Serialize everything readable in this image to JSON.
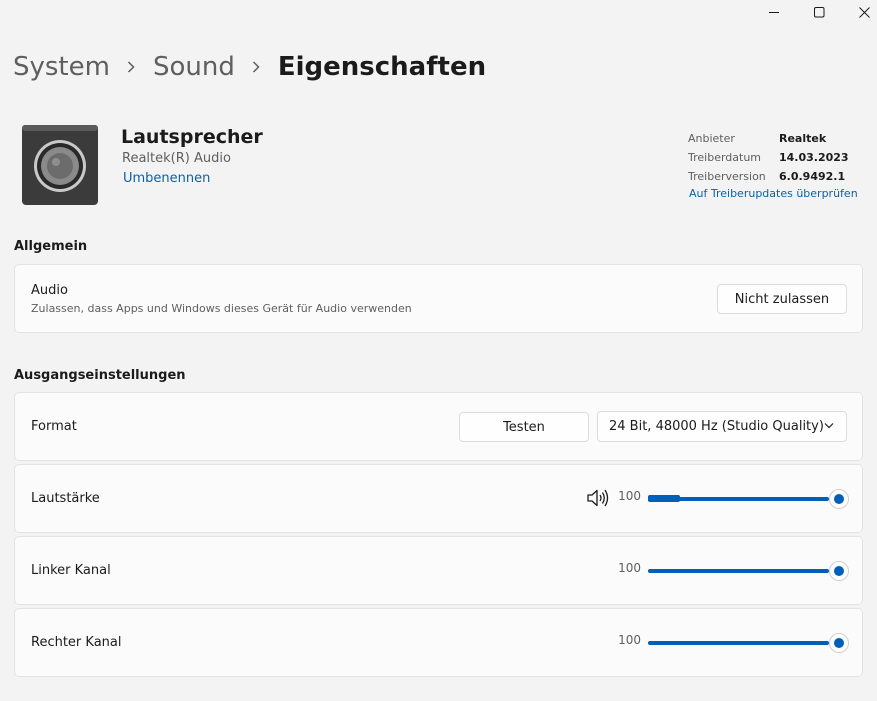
{
  "window_controls": {
    "minimize_icon": "minimize-icon",
    "maximize_icon": "maximize-icon",
    "close_icon": "close-icon"
  },
  "breadcrumb": [
    "System",
    "Sound",
    "Eigenschaften"
  ],
  "device": {
    "icon": "speaker-icon",
    "name": "Lautsprecher",
    "subtitle": "Realtek(R) Audio",
    "rename_link": "Umbenennen"
  },
  "driver_info": {
    "rows": [
      {
        "label": "Anbieter",
        "value": "Realtek"
      },
      {
        "label": "Treiberdatum",
        "value": "14.03.2023"
      },
      {
        "label": "Treiberversion",
        "value": "6.0.9492.1"
      }
    ],
    "update_link": "Auf Treiberupdates überprüfen"
  },
  "general": {
    "title": "Allgemein",
    "audio": {
      "label": "Audio",
      "description": "Zulassen, dass Apps und Windows dieses Gerät für Audio verwenden",
      "button": "Nicht zulassen"
    }
  },
  "output": {
    "title": "Ausgangseinstellungen",
    "format": {
      "label": "Format",
      "test_button": "Testen",
      "selected": "24 Bit, 48000 Hz (Studio Quality)"
    },
    "volume": {
      "label": "Lautstärke",
      "value": "100",
      "icon": "volume-icon",
      "level": 1.0
    },
    "left_channel": {
      "label": "Linker Kanal",
      "value": "100",
      "level": 1.0
    },
    "right_channel": {
      "label": "Rechter Kanal",
      "value": "100",
      "level": 1.0
    }
  },
  "colors": {
    "accent": "#005fb8",
    "link": "#0f5fa6",
    "background": "#f3f3f3",
    "card": "#fbfbfb"
  }
}
